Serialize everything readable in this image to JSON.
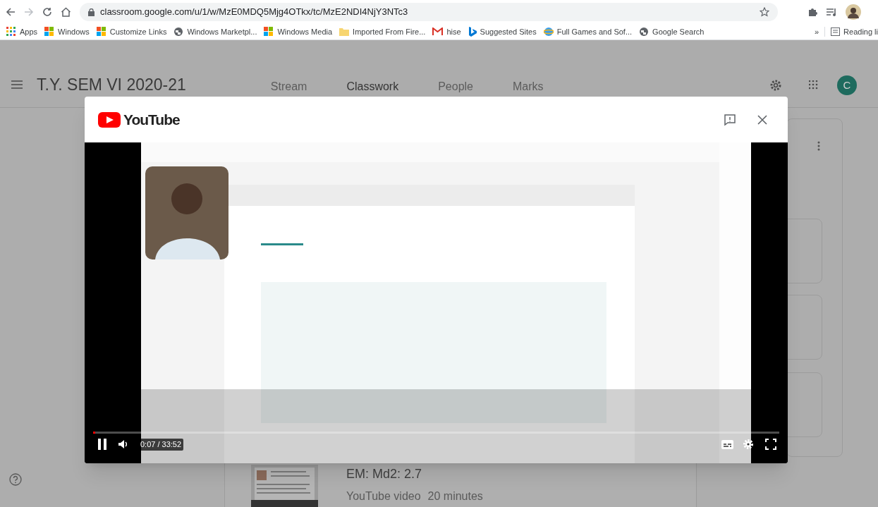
{
  "browser": {
    "url": "classroom.google.com/u/1/w/MzE0MDQ5Mjg4OTkx/tc/MzE2NDI4NjY3NTc3",
    "bookmarks": [
      {
        "label": "Apps",
        "kind": "apps"
      },
      {
        "label": "Windows",
        "kind": "windows"
      },
      {
        "label": "Customize Links",
        "kind": "windows"
      },
      {
        "label": "Windows Marketpl...",
        "kind": "globe"
      },
      {
        "label": "Windows Media",
        "kind": "windows"
      },
      {
        "label": "Imported From Fire...",
        "kind": "folder"
      },
      {
        "label": "hise",
        "kind": "gmail"
      },
      {
        "label": "Suggested Sites",
        "kind": "bing"
      },
      {
        "label": "Full Games and Sof...",
        "kind": "ie"
      },
      {
        "label": "Google Search",
        "kind": "globe"
      }
    ],
    "overflow": "»",
    "reading_list": "Reading li"
  },
  "classroom": {
    "title": "T.Y. SEM VI 2020-21",
    "tabs": [
      {
        "label": "Stream",
        "selected": false
      },
      {
        "label": "Classwork",
        "selected": true
      },
      {
        "label": "People",
        "selected": false
      },
      {
        "label": "Marks",
        "selected": false
      }
    ],
    "avatar": "C",
    "material": {
      "title": "EM: Md2: 2.7",
      "type": "YouTube video",
      "duration": "20 minutes"
    }
  },
  "player": {
    "brand": "YouTube",
    "playing": true,
    "time": "0:07 / 33:52",
    "level": 0.0035
  }
}
